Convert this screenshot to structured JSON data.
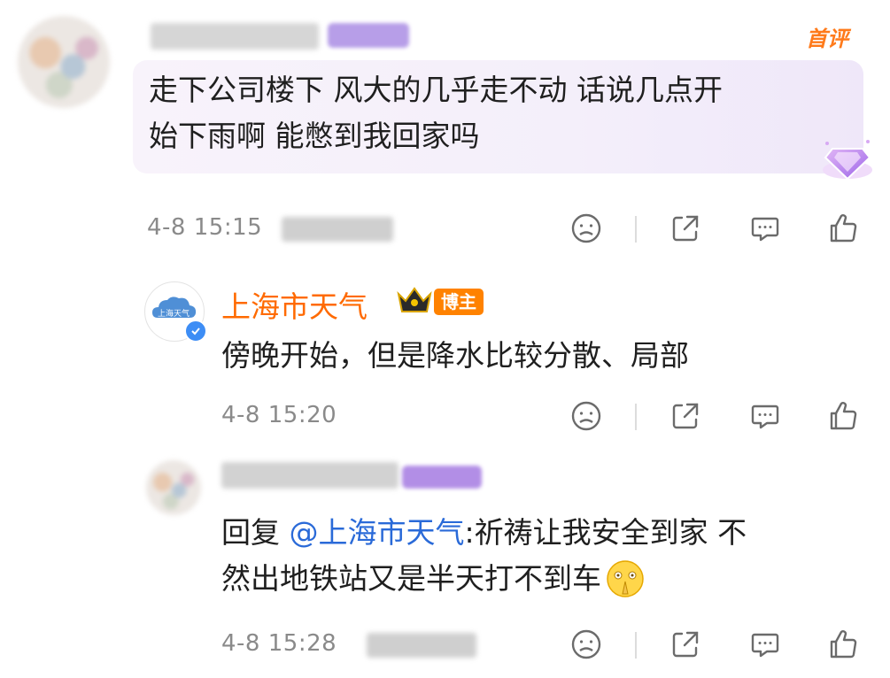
{
  "comment1": {
    "badge": "首评",
    "text": "走下公司楼下 风大的几乎走不动 话说几点开始下雨啊 能憋到我回家吗",
    "line1": "走下公司楼下 风大的几乎走不动 话说几点开",
    "line2": "始下雨啊 能憋到我回家吗",
    "time": "4-8 15:15"
  },
  "reply1": {
    "author": "上海市天气",
    "author_badge": "博主",
    "avatar_text": "上海天气",
    "text": "傍晚开始，但是降水比较分散、局部",
    "time": "4-8 15:20"
  },
  "reply2": {
    "prefix": "回复 ",
    "mention": "@上海市天气",
    "line1_rest": ":祈祷让我安全到家 不",
    "line2": "然出地铁站又是半天打不到车",
    "time": "4-8 15:28"
  },
  "icons": [
    "dislike-icon",
    "share-icon",
    "comment-icon",
    "like-icon"
  ],
  "colors": {
    "orange": "#ff6a00",
    "blue": "#2a6ad8",
    "gray": "#8a8a8a"
  }
}
